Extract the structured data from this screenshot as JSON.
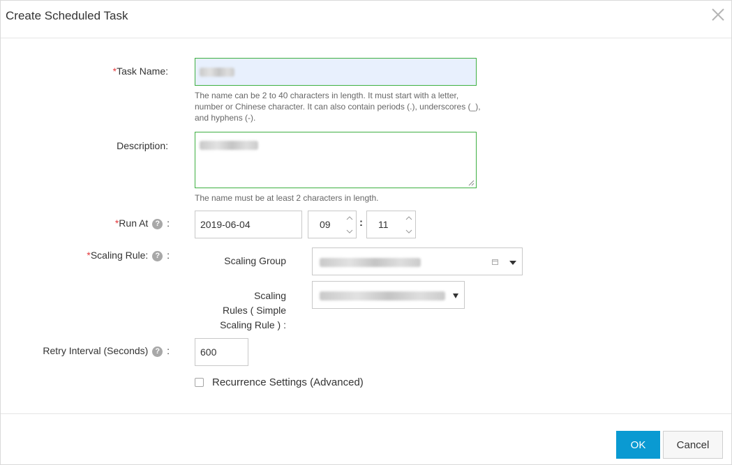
{
  "dialog": {
    "title": "Create Scheduled Task",
    "close_icon": "close-icon"
  },
  "form": {
    "task_name": {
      "label": "Task Name:",
      "required_mark": "*",
      "hint": "The name can be 2 to 40 characters in length. It must start with a letter, number or Chinese character. It can also contain periods (.), underscores (_), and hyphens (-)."
    },
    "description": {
      "label": "Description:",
      "hint": "The name must be at least 2 characters in length."
    },
    "run_at": {
      "label": "Run At",
      "required_mark": "*",
      "help_icon": "?",
      "suffix": ":",
      "date": "2019-06-04",
      "hour": "09",
      "minute": "11",
      "separator": ":"
    },
    "scaling_rule": {
      "label": "Scaling Rule:",
      "required_mark": "*",
      "help_icon": "?",
      "suffix": ":",
      "scaling_group_label": "Scaling Group",
      "scaling_rules_label_line1": "Scaling",
      "scaling_rules_label_line2": "Rules ( Simple",
      "scaling_rules_label_line3": "Scaling Rule ) :"
    },
    "retry_interval": {
      "label": "Retry Interval (Seconds)",
      "help_icon": "?",
      "suffix": ":",
      "value": "600"
    },
    "recurrence": {
      "label": "Recurrence Settings (Advanced)",
      "checked": false
    }
  },
  "footer": {
    "ok_label": "OK",
    "cancel_label": "Cancel"
  },
  "colors": {
    "accent": "#0a9ad2",
    "required": "#e4393c",
    "valid_border": "#3daf41"
  }
}
